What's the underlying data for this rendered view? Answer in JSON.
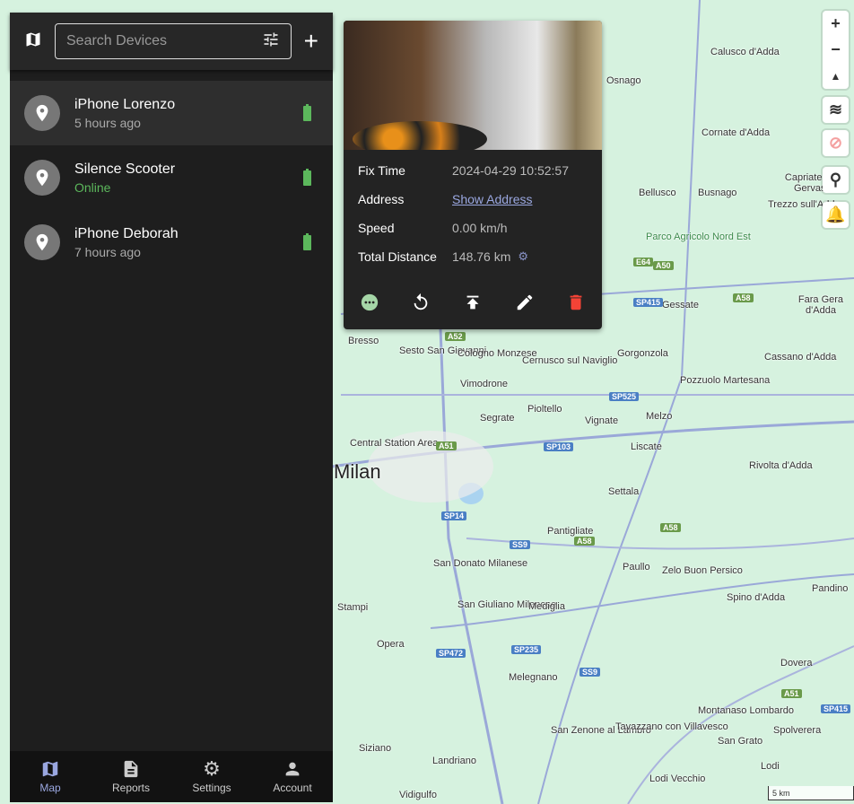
{
  "search": {
    "placeholder": "Search Devices"
  },
  "devices": [
    {
      "name": "iPhone Lorenzo",
      "status": "5 hours ago",
      "selected": true
    },
    {
      "name": "Silence Scooter",
      "status": "Online",
      "online": true
    },
    {
      "name": "iPhone Deborah",
      "status": "7 hours ago"
    }
  ],
  "nav": [
    {
      "label": "Map"
    },
    {
      "label": "Reports"
    },
    {
      "label": "Settings"
    },
    {
      "label": "Account"
    }
  ],
  "popup": {
    "fix_time_label": "Fix Time",
    "fix_time": "2024-04-29 10:52:57",
    "address_label": "Address",
    "address": "Show Address",
    "speed_label": "Speed",
    "speed": "0.00 km/h",
    "distance_label": "Total Distance",
    "distance": "148.76 km"
  },
  "map": {
    "scale": "5 km",
    "labels": [
      "Milan",
      "Sesto San Giovanni",
      "Cologno Monzese",
      "Vimodrone",
      "Segrate",
      "Pioltello",
      "Vignate",
      "Melzo",
      "Cernusco sul Naviglio",
      "Gorgonzola",
      "Pozzuolo Martesana",
      "Liscate",
      "Settala",
      "Pantigliate",
      "Paullo",
      "Zelo Buon Persico",
      "San Donato Milanese",
      "San Giuliano Milanese",
      "Mediglia",
      "Melegnano",
      "Opera",
      "Stampi",
      "Siziano",
      "Landriano",
      "Vidigulfo",
      "Lodi Vecchio",
      "Lodi",
      "San Zenone al Lambro",
      "Tavazzano con Villavesco",
      "Montanaso Lombardo",
      "San Grato",
      "Spino d'Adda",
      "Rivolta d'Adda",
      "Dovera",
      "Spolverera",
      "Bellusco",
      "Busnago",
      "Cornate d'Adda",
      "Calusco d'Adda",
      "Osnago",
      "Parco Agricolo Nord Est",
      "Gessate",
      "Fara Gera d'Adda",
      "Cassano d'Adda",
      "Bresso",
      "Trezzo sull'Adda",
      "Capriate San Gervasio",
      "Central Station Area",
      "Pandino"
    ],
    "shields": [
      "A52",
      "A51",
      "SP14",
      "SP103",
      "SP525",
      "A58",
      "E64",
      "SP415",
      "A50",
      "SS9",
      "SP472",
      "SP235",
      "A51",
      "SP415",
      "A58",
      "A58",
      "SS9"
    ]
  },
  "colors": {
    "accent": "#9aa7e0",
    "online": "#5cb85c",
    "delete": "#f44336",
    "more": "#a5d6a7"
  }
}
